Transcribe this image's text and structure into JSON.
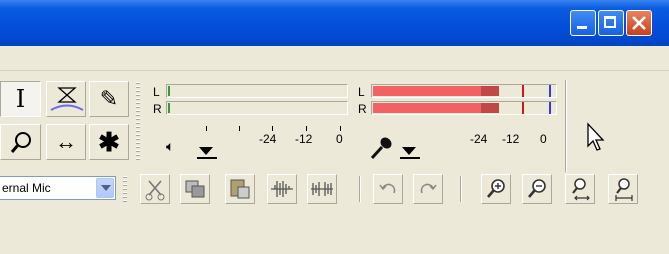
{
  "window": {
    "controls": [
      "minimize-icon",
      "maximize-icon",
      "close-icon"
    ]
  },
  "tools": [
    {
      "name": "selection-tool",
      "icon": "ibeam-icon",
      "glyph": "I",
      "selected": true
    },
    {
      "name": "envelope-tool",
      "icon": "envelope-icon"
    },
    {
      "name": "draw-tool",
      "icon": "pencil-icon",
      "glyph": "✎"
    },
    {
      "name": "zoom-tool",
      "icon": "magnifier-icon"
    },
    {
      "name": "timeshift-tool",
      "icon": "double-arrow-icon",
      "glyph": "↔"
    },
    {
      "name": "multi-tool",
      "icon": "asterisk-icon",
      "glyph": "✱"
    }
  ],
  "meters": {
    "playback": {
      "channels": [
        "L",
        "R"
      ],
      "ticks": [
        "-24",
        "-12",
        "0"
      ],
      "icon": "speaker-icon"
    },
    "recording": {
      "channels": [
        "L",
        "R"
      ],
      "ticks": [
        "-24",
        "-12",
        "0"
      ],
      "icon": "microphone-icon",
      "level": 0.93,
      "color": "#f26262"
    }
  },
  "input_source": {
    "value": "ernal Mic"
  },
  "edit_buttons": [
    "cut-icon",
    "copy-icon",
    "paste-icon",
    "trim-icon",
    "silence-icon",
    "undo-icon",
    "redo-icon",
    "zoom-in-icon",
    "zoom-out-icon",
    "fit-selection-icon",
    "fit-project-icon"
  ],
  "cursor": "mouse-pointer-icon"
}
